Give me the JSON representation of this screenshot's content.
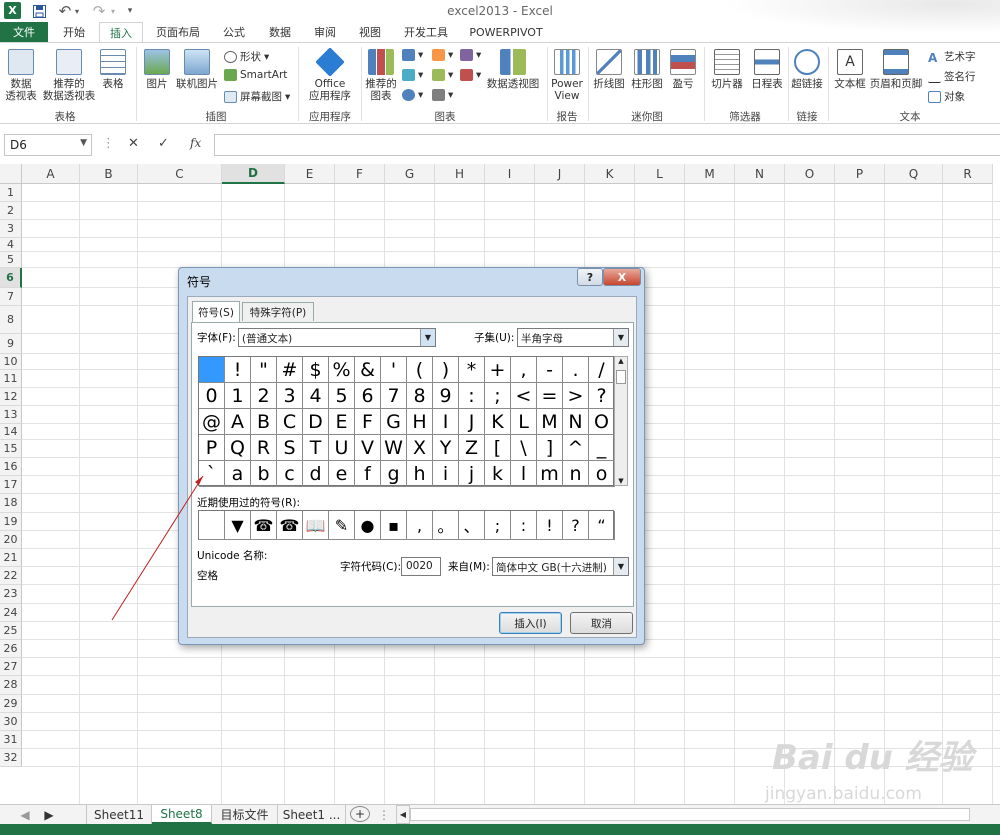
{
  "window": {
    "title": "excel2013 - Excel",
    "logo": "X"
  },
  "qat": {
    "save": "save-icon",
    "undo": "↶",
    "redo": "↷",
    "more": "▾"
  },
  "tabs": [
    "文件",
    "开始",
    "插入",
    "页面布局",
    "公式",
    "数据",
    "审阅",
    "视图",
    "开发工具",
    "POWERPIVOT"
  ],
  "ribbon": {
    "pivot": "数据\n透视表",
    "rec_pivot": "推荐的\n数据透视表",
    "table": "表格",
    "group_tables": "表格",
    "picture": "图片",
    "online_pic": "联机图片",
    "shapes": "形状",
    "smartart": "SmartArt",
    "screenshot": "屏幕截图",
    "group_illus": "插图",
    "office_app": "Office\n应用程序",
    "group_apps": "应用程序",
    "rec_charts": "推荐的\n图表",
    "pivot_chart": "数据透视图",
    "group_charts": "图表",
    "power_view": "Power\nView",
    "group_reports": "报告",
    "spark_line": "折线图",
    "spark_col": "柱形图",
    "spark_wl": "盈亏",
    "group_spark": "迷你图",
    "slicer": "切片器",
    "timeline": "日程表",
    "group_filter": "筛选器",
    "hyperlink": "超链接",
    "group_links": "链接",
    "textbox": "文本框",
    "header_footer": "页眉和页脚",
    "wordart": "艺术字",
    "signature": "签名行",
    "object": "对象",
    "group_text": "文本"
  },
  "formula_bar": {
    "namebox": "D6",
    "cancel": "✕",
    "enter": "✓",
    "fx": "fx",
    "value": ""
  },
  "columns": [
    "A",
    "B",
    "C",
    "D",
    "E",
    "F",
    "G",
    "H",
    "I",
    "J",
    "K",
    "L",
    "M",
    "N",
    "O",
    "P",
    "Q",
    "R"
  ],
  "rows": [
    "1",
    "2",
    "3",
    "4",
    "5",
    "6",
    "7",
    "8",
    "9",
    "10",
    "11",
    "12",
    "13",
    "14",
    "15",
    "16",
    "17",
    "18",
    "19",
    "20",
    "21",
    "22",
    "23",
    "24",
    "25",
    "26",
    "27",
    "28",
    "29",
    "30",
    "31",
    "32"
  ],
  "selected_cell": "D6",
  "sheets": {
    "tabs": [
      "Sheet11",
      "Sheet8",
      "目标文件",
      "Sheet1 ..."
    ],
    "active": "Sheet8",
    "add": "+"
  },
  "dialog": {
    "title": "符号",
    "help": "?",
    "close": "X",
    "tab_symbol": "符号(S)",
    "tab_special": "特殊字符(P)",
    "font_label": "字体(F):",
    "font_value": "(普通文本)",
    "subset_label": "子集(U):",
    "subset_value": "半角字母",
    "symbols": [
      " ",
      "!",
      "\"",
      "#",
      "$",
      "%",
      "&",
      "'",
      "(",
      ")",
      "*",
      "+",
      ",",
      "-",
      ".",
      "/",
      "0",
      "1",
      "2",
      "3",
      "4",
      "5",
      "6",
      "7",
      "8",
      "9",
      ":",
      ";",
      "<",
      "=",
      ">",
      "?",
      "@",
      "A",
      "B",
      "C",
      "D",
      "E",
      "F",
      "G",
      "H",
      "I",
      "J",
      "K",
      "L",
      "M",
      "N",
      "O",
      "P",
      "Q",
      "R",
      "S",
      "T",
      "U",
      "V",
      "W",
      "X",
      "Y",
      "Z",
      "[",
      "\\",
      "]",
      "^",
      "_",
      "`",
      "a",
      "b",
      "c",
      "d",
      "e",
      "f",
      "g",
      "h",
      "i",
      "j",
      "k",
      "l",
      "m",
      "n",
      "o"
    ],
    "recent_label": "近期使用过的符号(R):",
    "recent": [
      " ",
      "▼",
      "☎",
      "☎",
      "📖",
      "✎",
      "●",
      "▪",
      ",",
      "。",
      "、",
      ";",
      ":",
      "!",
      "?",
      "“"
    ],
    "unicode_label": "Unicode 名称:",
    "unicode_name": "空格",
    "code_label": "字符代码(C):",
    "code_value": "0020",
    "from_label": "来自(M):",
    "from_value": "简体中文 GB(十六进制)",
    "insert": "插入(I)",
    "cancel": "取消"
  },
  "watermark": {
    "brand": "Bai du 经验",
    "url": "jingyan.baidu.com"
  },
  "colors": {
    "excel_green": "#217346",
    "selected": "#3399ff"
  }
}
